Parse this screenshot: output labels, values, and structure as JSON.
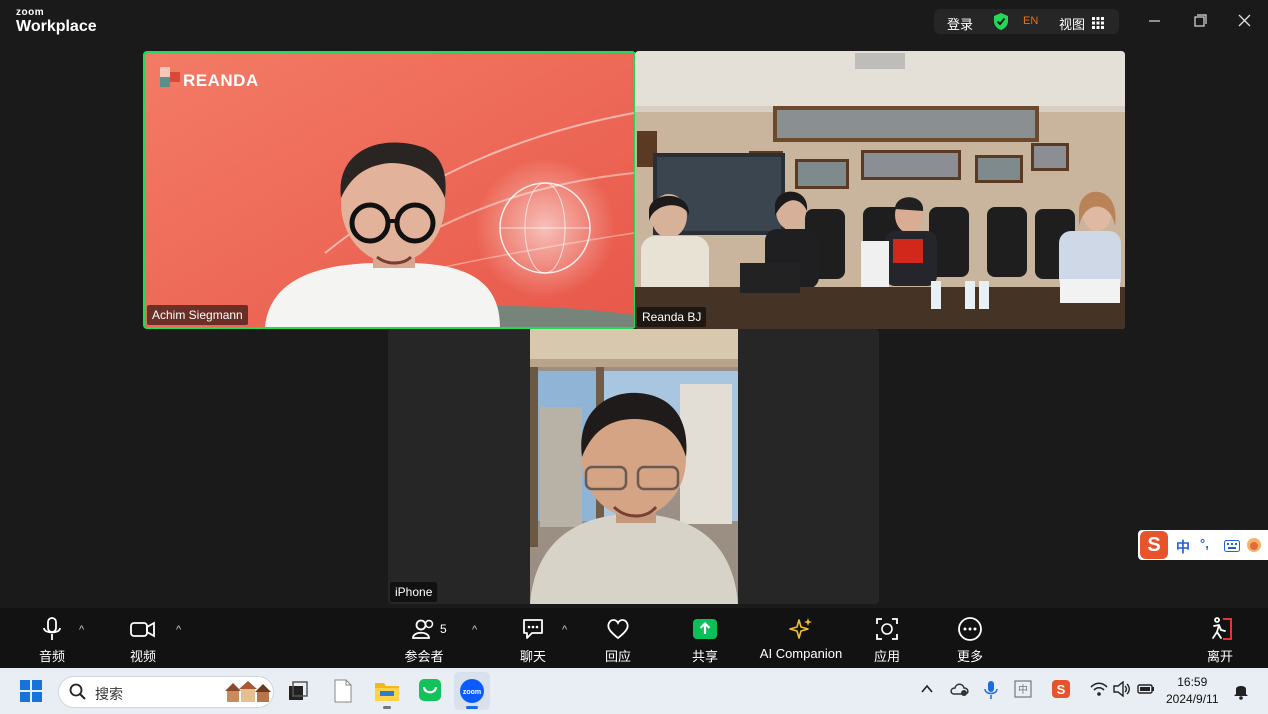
{
  "app": {
    "logo_line1": "zoom",
    "logo_line2": "Workplace"
  },
  "titlebar": {
    "login_label": "登录",
    "lang_label": "EN",
    "view_label": "视图",
    "shield_color": "#23d959"
  },
  "participants": [
    {
      "name": "Achim Siegmann",
      "speaking": true,
      "bg_text": "REANDA"
    },
    {
      "name": "Reanda BJ",
      "speaking": false
    },
    {
      "name": "iPhone",
      "speaking": false
    }
  ],
  "toolbar": {
    "audio_label": "音频",
    "video_label": "视频",
    "participants_label": "参会者",
    "participants_count": "5",
    "chat_label": "聊天",
    "react_label": "回应",
    "share_label": "共享",
    "ai_label": "AI Companion",
    "apps_label": "应用",
    "more_label": "更多",
    "leave_label": "离开"
  },
  "ime": {
    "mode": "中",
    "punct": "°,"
  },
  "taskbar": {
    "search_placeholder": "搜索",
    "time": "16:59",
    "date": "2024/9/11"
  },
  "colors": {
    "accent_green": "#23d959",
    "share_green": "#0bbf5a",
    "ai_yellow": "#f3c12a",
    "leave_red": "#e5343a",
    "reanda_bg": "#ef6a55"
  }
}
